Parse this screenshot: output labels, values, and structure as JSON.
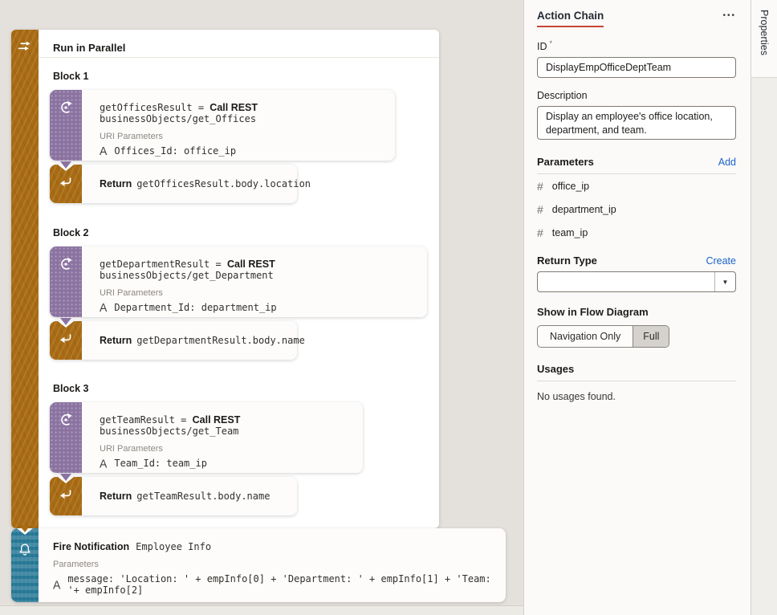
{
  "icons": {
    "overflow_menu": "•••",
    "dropdown": "▼",
    "hash": "#",
    "assign": "A"
  },
  "canvas": {
    "parallel": {
      "title": "Run in Parallel",
      "blocks": [
        {
          "label": "Block 1",
          "call": {
            "result": "getOfficesResult",
            "operator": "=",
            "action": "Call REST",
            "endpoint": "businessObjects/get_Offices",
            "params_label": "URI Parameters",
            "assignment": "Offices_Id: office_ip"
          },
          "return": {
            "label": "Return",
            "expression": "getOfficesResult.body.location"
          }
        },
        {
          "label": "Block 2",
          "call": {
            "result": "getDepartmentResult",
            "operator": "=",
            "action": "Call REST",
            "endpoint": "businessObjects/get_Department",
            "params_label": "URI Parameters",
            "assignment": "Department_Id: department_ip"
          },
          "return": {
            "label": "Return",
            "expression": "getDepartmentResult.body.name"
          }
        },
        {
          "label": "Block 3",
          "call": {
            "result": "getTeamResult",
            "operator": "=",
            "action": "Call REST",
            "endpoint": "businessObjects/get_Team",
            "params_label": "URI Parameters",
            "assignment": "Team_Id: team_ip"
          },
          "return": {
            "label": "Return",
            "expression": "getTeamResult.body.name"
          }
        }
      ]
    },
    "notification": {
      "title": "Fire Notification",
      "name": "Employee Info",
      "params_label": "Parameters",
      "assignment": "message: 'Location: ' + empInfo[0] + 'Department: ' + empInfo[1] + 'Team: '+ empInfo[2]"
    }
  },
  "panel": {
    "title": "Action Chain",
    "id": {
      "label": "ID",
      "required_mark": "*",
      "value": "DisplayEmpOfficeDeptTeam"
    },
    "description": {
      "label": "Description",
      "value": "Display an employee's office location, department, and team."
    },
    "parameters": {
      "label": "Parameters",
      "action": "Add",
      "items": [
        "office_ip",
        "department_ip",
        "team_ip"
      ]
    },
    "return_type": {
      "label": "Return Type",
      "action": "Create",
      "value": ""
    },
    "flow_diagram": {
      "label": "Show in Flow Diagram",
      "options": [
        {
          "label": "Navigation Only",
          "selected": false
        },
        {
          "label": "Full",
          "selected": true
        }
      ]
    },
    "usages": {
      "label": "Usages",
      "empty": "No usages found."
    }
  },
  "rail": {
    "tab": "Properties"
  },
  "colors": {
    "accent_red": "#c74634",
    "strip_orange": "#a86b13",
    "strip_purple": "#8b73a1",
    "strip_teal": "#2b7d9b",
    "link_blue": "#1b62c8"
  }
}
